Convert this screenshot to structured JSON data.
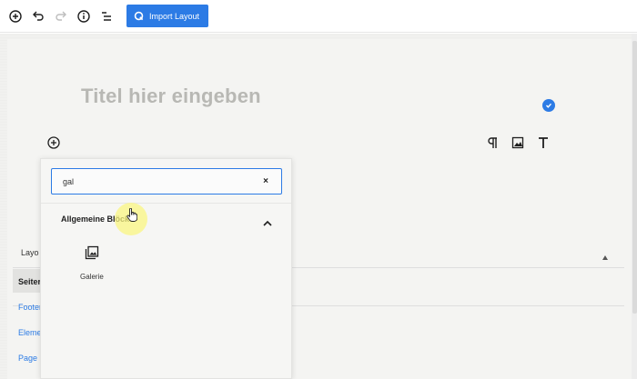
{
  "toolbar": {
    "icons": [
      "add-circle-icon",
      "undo-icon",
      "redo-icon",
      "info-icon",
      "list-view-icon"
    ],
    "import_label": "Import Layout"
  },
  "editor": {
    "title_placeholder": "Titel hier eingeben"
  },
  "inserter": {
    "search_value": "gal",
    "clear_symbol": "×",
    "section_title": "Allgemeine Blöcke",
    "blocks": [
      {
        "label": "Galerie",
        "icon": "gallery-icon"
      }
    ]
  },
  "background_panel": {
    "tab_label": "Layo",
    "selected_item": "Seiter",
    "links": [
      "Footer",
      "Eleme",
      "Page E"
    ]
  },
  "colors": {
    "accent": "#2c7be5",
    "cursor_highlight": "#f7f27a"
  }
}
